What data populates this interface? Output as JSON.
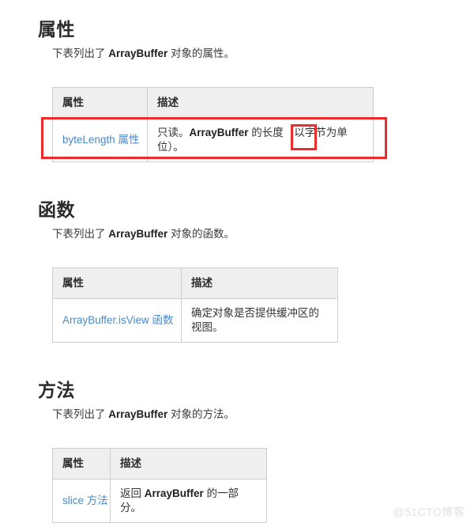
{
  "page": {
    "background_color": "#ffffff",
    "link_color": "#4a89c7",
    "annotation_color": "#ee2b2b",
    "header_fill": "#efefef",
    "border_color": "#cfcfcf"
  },
  "sections": [
    {
      "id": "properties",
      "heading": "属性",
      "description_prefix": "下表列出了 ",
      "description_bold": "ArrayBuffer",
      "description_suffix": " 对象的属性。",
      "table": {
        "columns": [
          "属性",
          "描述"
        ],
        "rows": [
          {
            "name": "byteLength 属性",
            "name_is_link": true,
            "desc_prefix": "只读。",
            "desc_bold": "ArrayBuffer",
            "desc_suffix": " 的长度（以字节为单位）。"
          }
        ]
      }
    },
    {
      "id": "functions",
      "heading": "函数",
      "description_prefix": "下表列出了 ",
      "description_bold": "ArrayBuffer",
      "description_suffix": " 对象的函数。",
      "table": {
        "columns": [
          "属性",
          "描述"
        ],
        "rows": [
          {
            "name": "ArrayBuffer.isView 函数",
            "name_is_link": true,
            "desc_prefix": "确定对象是否提供缓冲区的视图。",
            "desc_bold": "",
            "desc_suffix": ""
          }
        ]
      }
    },
    {
      "id": "methods",
      "heading": "方法",
      "description_prefix": "下表列出了 ",
      "description_bold": "ArrayBuffer",
      "description_suffix": " 对象的方法。",
      "table": {
        "columns": [
          "属性",
          "描述"
        ],
        "rows": [
          {
            "name": "slice 方法",
            "name_is_link": true,
            "desc_prefix": "返回 ",
            "desc_bold": "ArrayBuffer",
            "desc_suffix": " 的一部分。"
          }
        ]
      }
    }
  ],
  "annotations": {
    "row_outline_label": "byteLength 属性 行高亮框",
    "word_highlight_label": "字节"
  },
  "watermark": {
    "text": "@51CTO博客"
  }
}
